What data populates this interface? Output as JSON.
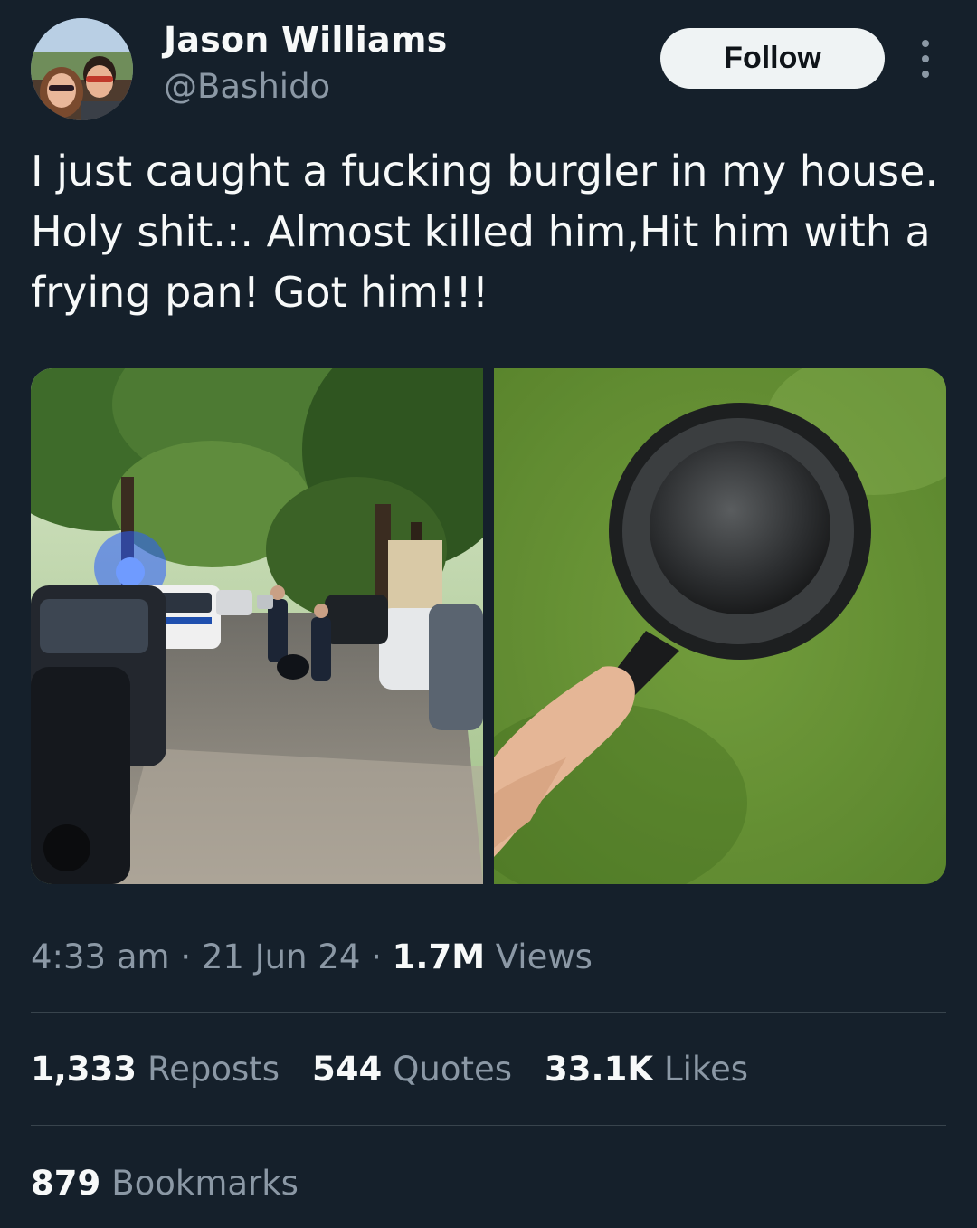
{
  "author": {
    "name": "Jason Williams",
    "handle": "@Bashido"
  },
  "follow_label": "Follow",
  "tweet": {
    "text": "I just caught a fucking burgler in my house. Holy shit.:. Almost killed him,Hit him with a frying pan! Got him!!!"
  },
  "meta": {
    "time": "4:33 am",
    "sep1": " · ",
    "date": "21 Jun 24",
    "sep2": " · ",
    "views_count": "1.7M",
    "views_label": " Views"
  },
  "stats": {
    "reposts_count": "1,333",
    "reposts_label": "Reposts",
    "quotes_count": "544",
    "quotes_label": "Quotes",
    "likes_count": "33.1K",
    "likes_label": "Likes",
    "bookmarks_count": "879",
    "bookmarks_label": "Bookmarks"
  },
  "icons": {
    "more": "more-horizontal-icon"
  },
  "colors": {
    "background": "#15202b",
    "text_primary": "#f7f9f9",
    "text_secondary": "#8b98a5",
    "follow_button_bg": "#eff3f4",
    "divider": "#38444d"
  }
}
